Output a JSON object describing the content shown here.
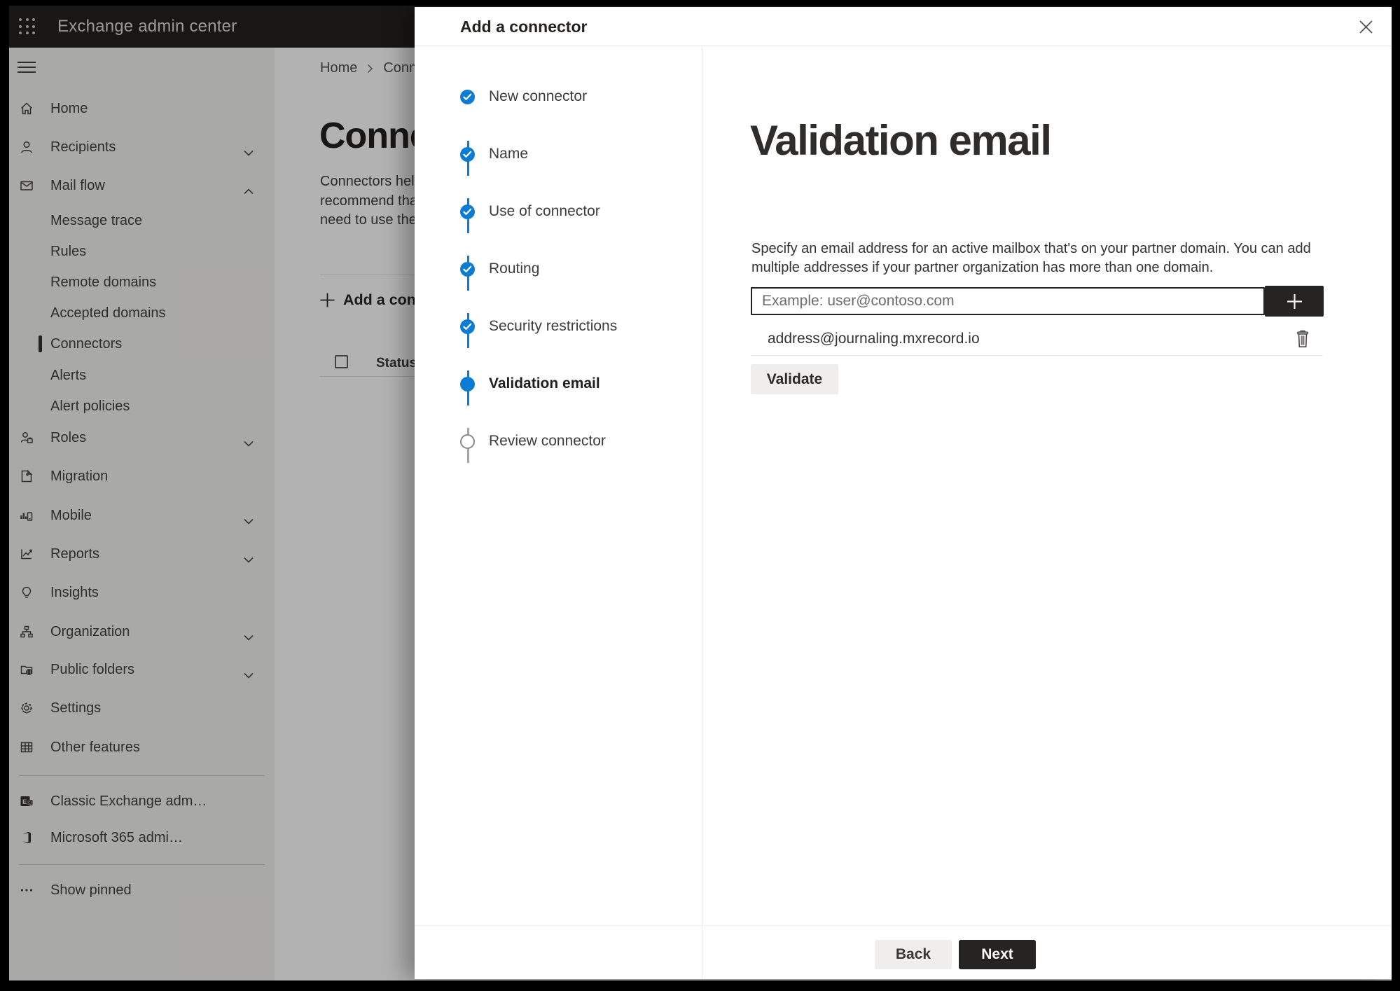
{
  "app_bar": {
    "title": "Exchange admin center"
  },
  "sidebar": {
    "items": [
      {
        "label": "Home"
      },
      {
        "label": "Recipients",
        "chevron": "down"
      },
      {
        "label": "Mail flow",
        "chevron": "up"
      },
      {
        "label": "Message trace"
      },
      {
        "label": "Rules"
      },
      {
        "label": "Remote domains"
      },
      {
        "label": "Accepted domains"
      },
      {
        "label": "Connectors",
        "selected": true
      },
      {
        "label": "Alerts"
      },
      {
        "label": "Alert policies"
      },
      {
        "label": "Roles",
        "chevron": "down"
      },
      {
        "label": "Migration"
      },
      {
        "label": "Mobile",
        "chevron": "down"
      },
      {
        "label": "Reports",
        "chevron": "down"
      },
      {
        "label": "Insights"
      },
      {
        "label": "Organization",
        "chevron": "down"
      },
      {
        "label": "Public folders",
        "chevron": "down"
      },
      {
        "label": "Settings"
      },
      {
        "label": "Other features"
      },
      {
        "label": "Classic Exchange adm…"
      },
      {
        "label": "Microsoft 365 admi…"
      },
      {
        "label": "Show pinned"
      }
    ]
  },
  "page": {
    "breadcrumb": {
      "home": "Home",
      "current": "Connectors"
    },
    "title": "Connectors",
    "description_lines": [
      "Connectors help",
      "recommend that",
      "need to use them"
    ],
    "add_connector_label": "Add a connector",
    "table": {
      "status_header": "Status"
    }
  },
  "modal": {
    "title": "Add a connector",
    "wizard": {
      "steps": [
        {
          "label": "New connector",
          "state": "done"
        },
        {
          "label": "Name",
          "state": "done"
        },
        {
          "label": "Use of connector",
          "state": "done"
        },
        {
          "label": "Routing",
          "state": "done"
        },
        {
          "label": "Security restrictions",
          "state": "done"
        },
        {
          "label": "Validation email",
          "state": "current"
        },
        {
          "label": "Review connector",
          "state": "todo"
        }
      ]
    },
    "content": {
      "title": "Validation email",
      "description_lines": [
        "Specify an email address for an active mailbox that's on your partner domain. You can add",
        "multiple addresses if your partner organization has more than one domain."
      ],
      "email_input": {
        "placeholder": "Example: user@contoso.com",
        "value": ""
      },
      "addresses": [
        "address@journaling.mxrecord.io"
      ],
      "validate_label": "Validate"
    },
    "footer": {
      "back_label": "Back",
      "next_label": "Next"
    }
  },
  "colors": {
    "accent_blue": "#0b7cd4",
    "dark_button": "#252422",
    "topbar": "#23211f"
  }
}
